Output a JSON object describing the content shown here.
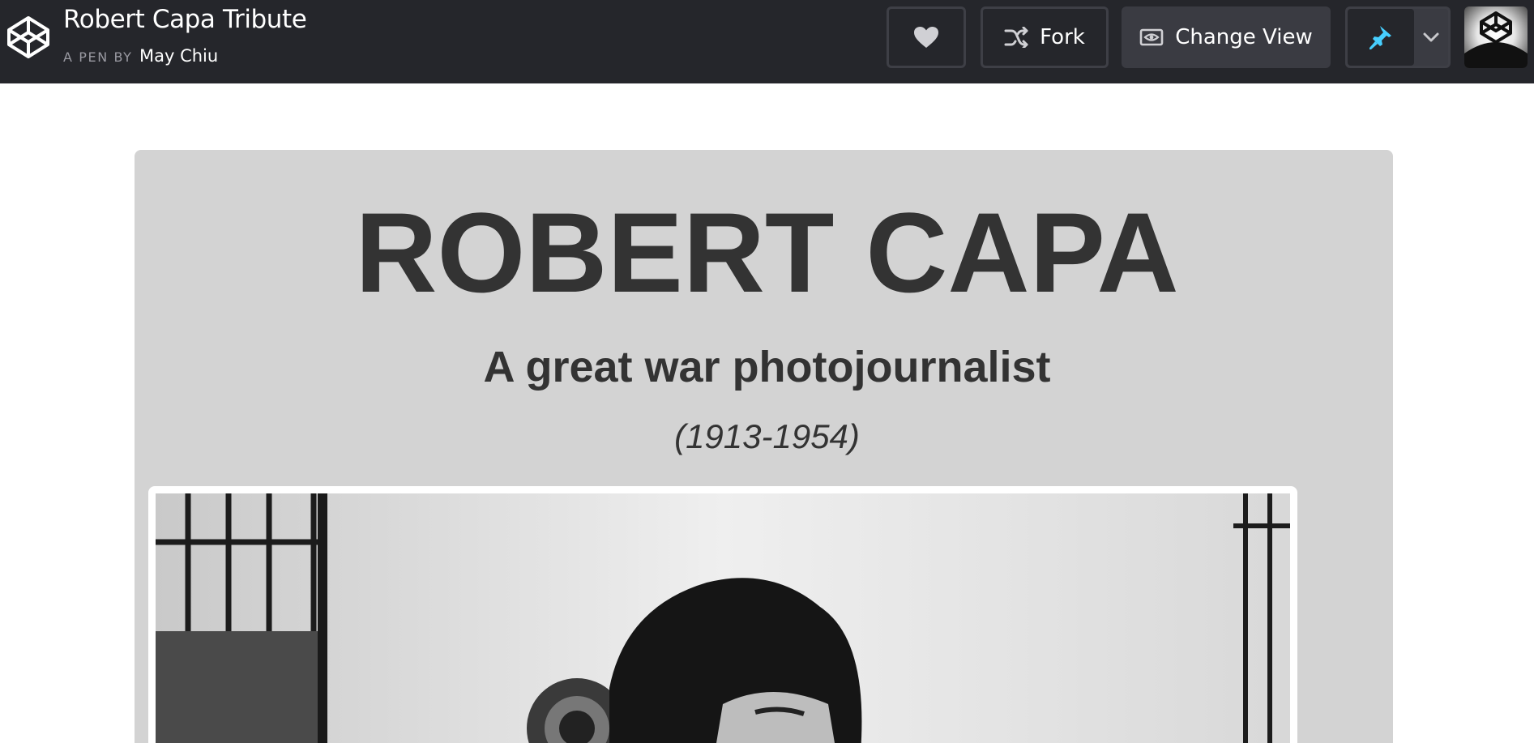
{
  "header": {
    "pen_title": "Robert Capa Tribute",
    "by_label": "A PEN BY",
    "author": "May Chiu",
    "fork_label": "Fork",
    "change_view_label": "Change View"
  },
  "colors": {
    "topbar_bg": "#25262b",
    "card_bg": "#d3d3d3",
    "text_dark": "#333333",
    "pin_accent": "#47cfff"
  },
  "icons": {
    "logo": "codepen-logo-icon",
    "heart": "heart-icon",
    "fork": "fork-icon",
    "change_view": "eye-icon",
    "pin": "pin-icon",
    "chevron": "chevron-down-icon"
  },
  "tribute": {
    "title": "ROBERT CAPA",
    "subtitle": "A great war photojournalist",
    "years": "(1913-1954)"
  }
}
